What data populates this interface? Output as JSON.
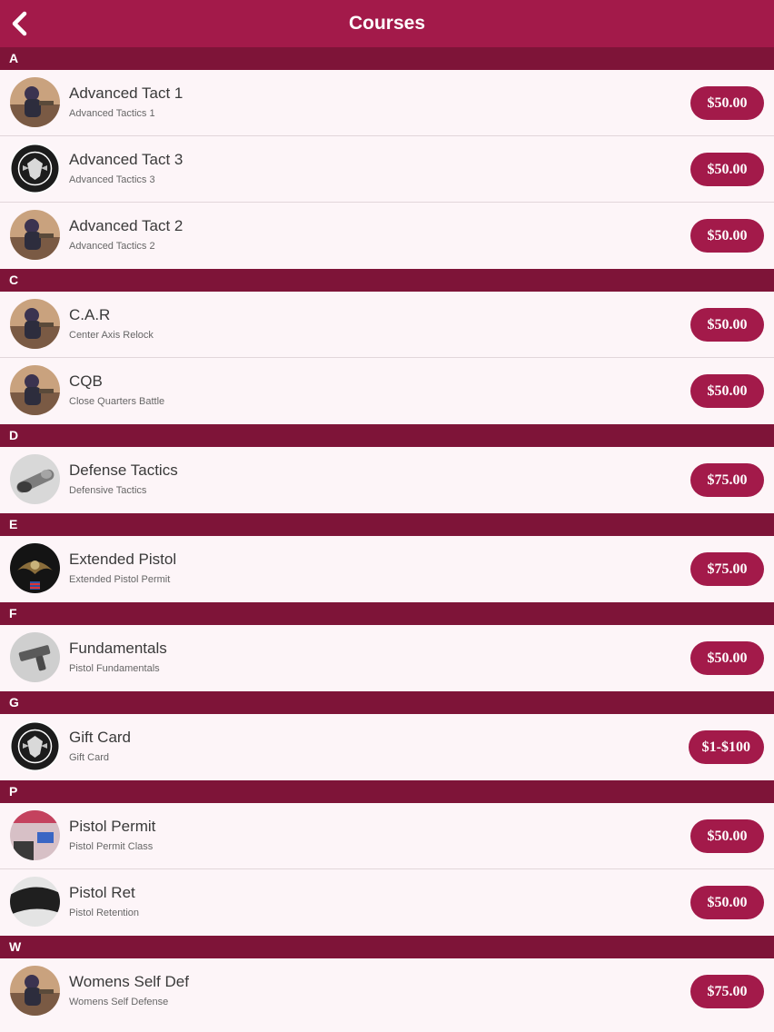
{
  "header": {
    "title": "Courses",
    "back_icon": "chevron-left-icon"
  },
  "colors": {
    "header_bg": "#a31a4a",
    "section_bg": "#7e1438",
    "row_bg": "#fdf5f8",
    "price_bg": "#a31a4a"
  },
  "sections": [
    {
      "letter": "A",
      "items": [
        {
          "title": "Advanced Tact 1",
          "subtitle": "Advanced Tactics 1",
          "price": "$50.00",
          "thumb": "photo-training-thumbnail"
        },
        {
          "title": "Advanced Tact 3",
          "subtitle": "Advanced Tactics 3",
          "price": "$50.00",
          "thumb": "defensor-logo-thumbnail"
        },
        {
          "title": "Advanced Tact 2",
          "subtitle": "Advanced Tactics 2",
          "price": "$50.00",
          "thumb": "photo-training-thumbnail"
        }
      ]
    },
    {
      "letter": "C",
      "items": [
        {
          "title": "C.A.R",
          "subtitle": "Center Axis Relock",
          "price": "$50.00",
          "thumb": "photo-training-thumbnail"
        },
        {
          "title": "CQB",
          "subtitle": "Close Quarters Battle",
          "price": "$50.00",
          "thumb": "photo-training-thumbnail"
        }
      ]
    },
    {
      "letter": "D",
      "items": [
        {
          "title": "Defense Tactics",
          "subtitle": "Defensive Tactics",
          "price": "$75.00",
          "thumb": "baton-photo-thumbnail"
        }
      ]
    },
    {
      "letter": "E",
      "items": [
        {
          "title": "Extended Pistol",
          "subtitle": "Extended Pistol Permit",
          "price": "$75.00",
          "thumb": "defensor-eagle-logo-thumbnail"
        }
      ]
    },
    {
      "letter": "F",
      "items": [
        {
          "title": "Fundamentals",
          "subtitle": "Pistol Fundamentals",
          "price": "$50.00",
          "thumb": "pistol-photo-thumbnail"
        }
      ]
    },
    {
      "letter": "G",
      "items": [
        {
          "title": "Gift Card",
          "subtitle": "Gift Card",
          "price": "$1-$100",
          "thumb": "defensor-logo-thumbnail"
        }
      ]
    },
    {
      "letter": "P",
      "items": [
        {
          "title": "Pistol Permit",
          "subtitle": "Pistol Permit Class",
          "price": "$50.00",
          "thumb": "classroom-photo-thumbnail"
        },
        {
          "title": "Pistol Ret",
          "subtitle": "Pistol Retention",
          "price": "$50.00",
          "thumb": "holster-photo-thumbnail"
        }
      ]
    },
    {
      "letter": "W",
      "items": [
        {
          "title": "Womens Self Def",
          "subtitle": "Womens Self Defense",
          "price": "$75.00",
          "thumb": "photo-training-thumbnail"
        }
      ]
    }
  ]
}
